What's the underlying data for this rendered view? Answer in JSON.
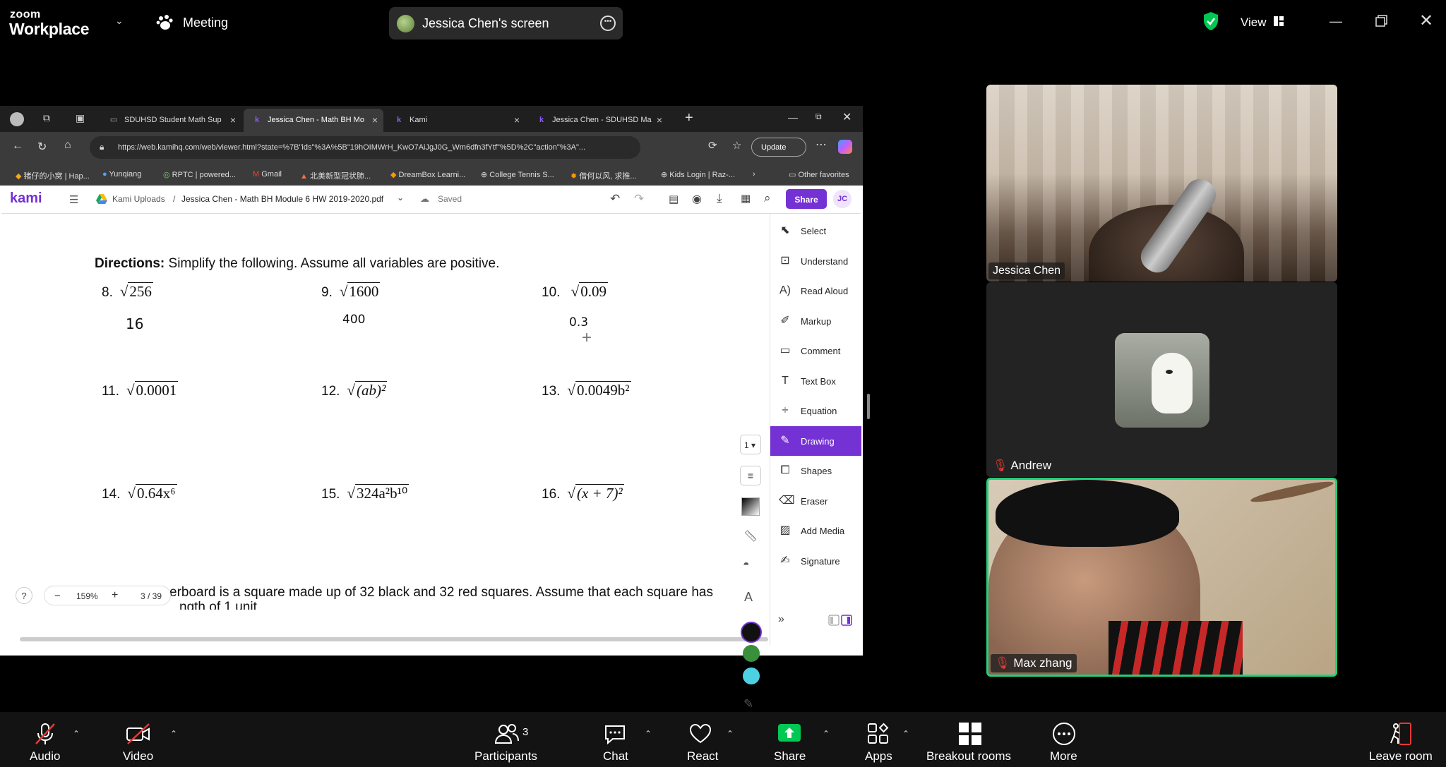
{
  "zoom": {
    "logo_line1": "zoom",
    "logo_line2": "Workplace",
    "meeting_label": "Meeting",
    "share_title": "Jessica Chen's screen",
    "view_label": "View"
  },
  "browser": {
    "tabs": [
      {
        "label": "SDUHSD Student Math Sup"
      },
      {
        "label": "Jessica Chen - Math BH Mo"
      },
      {
        "label": "Kami"
      },
      {
        "label": "Jessica Chen - SDUHSD Ma"
      }
    ],
    "url": "https://web.kamihq.com/web/viewer.html?state=%7B\"ids\"%3A%5B\"19hOIMWrH_KwO7AiJgJ0G_Wm6dfn3fYtf\"%5D%2C\"action\"%3A\"...",
    "update_label": "Update",
    "bookmarks": [
      "猪仔的小窝 | Hap...",
      "Yunqiang",
      "RPTC | powered...",
      "Gmail",
      "北美新型冠状肺...",
      "DreamBox Learni...",
      "College Tennis S...",
      "借何以风, 求推...",
      "Kids Login | Raz-...",
      "Other favorites"
    ]
  },
  "kami": {
    "logo": "kami",
    "breadcrumb_root": "Kami Uploads",
    "breadcrumb_sep": "/",
    "filename": "Jessica Chen - Math BH Module 6 HW 2019-2020.pdf",
    "saved": "Saved",
    "share": "Share",
    "avatar": "JC",
    "page_select": "1",
    "zoom_level": "159%",
    "page_indicator": "3 / 39",
    "help": "?",
    "tools": [
      {
        "label": "Select",
        "icon": "cursor-icon"
      },
      {
        "label": "Understand",
        "icon": "understand-icon"
      },
      {
        "label": "Read Aloud",
        "icon": "read-aloud-icon"
      },
      {
        "label": "Markup",
        "icon": "markup-icon"
      },
      {
        "label": "Comment",
        "icon": "comment-icon"
      },
      {
        "label": "Text Box",
        "icon": "text-box-icon"
      },
      {
        "label": "Equation",
        "icon": "equation-icon"
      },
      {
        "label": "Drawing",
        "icon": "pen-icon"
      },
      {
        "label": "Shapes",
        "icon": "shapes-icon"
      },
      {
        "label": "Eraser",
        "icon": "eraser-icon"
      },
      {
        "label": "Add Media",
        "icon": "add-media-icon"
      },
      {
        "label": "Signature",
        "icon": "signature-icon"
      }
    ],
    "active_tool": "Drawing",
    "colors": [
      "#111111",
      "#3a8f3a",
      "#4dd0e1"
    ]
  },
  "worksheet": {
    "directions_bold": "Directions:",
    "directions_text": " Simplify the following. Assume all variables are positive.",
    "problems": [
      {
        "n": "8.",
        "expr": "256"
      },
      {
        "n": "9.",
        "expr": "1600"
      },
      {
        "n": "10.",
        "expr": "0.09"
      },
      {
        "n": "11.",
        "expr": "0.0001"
      },
      {
        "n": "12.",
        "expr": "(ab)²"
      },
      {
        "n": "13.",
        "expr": "0.0049b²"
      },
      {
        "n": "14.",
        "expr": "0.64x⁶"
      },
      {
        "n": "15.",
        "expr": "324a²b¹⁰"
      },
      {
        "n": "16.",
        "expr": "(x + 7)²"
      }
    ],
    "handwritten": [
      "16",
      "400",
      "0.3"
    ],
    "bottom_text": "erboard is a square made up of 32 black and 32 red squares. Assume that each square has",
    "bottom_text2": "ngth of 1 unit"
  },
  "participants_tiles": [
    {
      "name": "Jessica Chen"
    },
    {
      "name": "Andrew"
    },
    {
      "name": "Max zhang"
    }
  ],
  "bottom_bar": {
    "audio": "Audio",
    "video": "Video",
    "participants": "Participants",
    "participants_count": "3",
    "chat": "Chat",
    "react": "React",
    "share": "Share",
    "apps": "Apps",
    "breakout": "Breakout rooms",
    "more": "More",
    "leave": "Leave room"
  },
  "accent_colors": {
    "kami_purple": "#7431d3",
    "zoom_green": "#00c853",
    "active_speaker": "#22d17a"
  }
}
